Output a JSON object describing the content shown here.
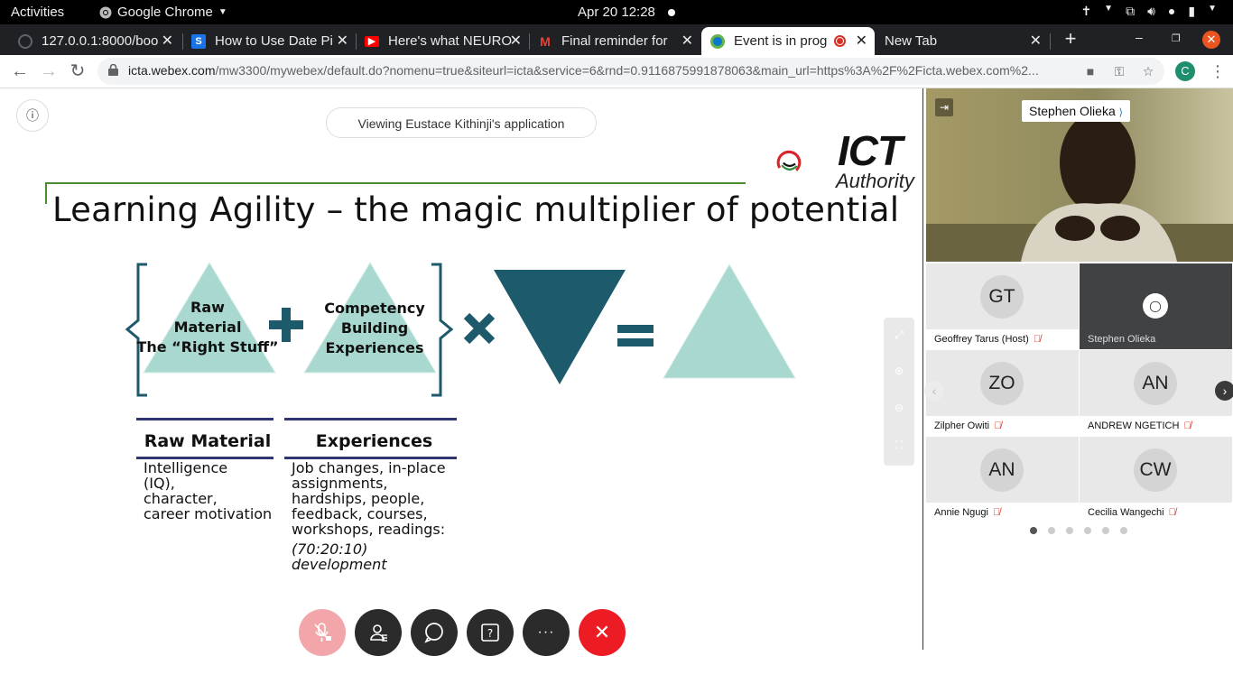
{
  "system": {
    "activities": "Activities",
    "app_name": "Google Chrome",
    "clock": "Apr 20  12:28"
  },
  "tabs": [
    {
      "title": "127.0.0.1:8000/boo",
      "favicon": "globe-icon"
    },
    {
      "title": "How to Use Date Pi",
      "favicon": "s-icon",
      "color": "#1a73e8"
    },
    {
      "title": "Here's what NEURO",
      "favicon": "youtube-icon",
      "color": "#ff0000"
    },
    {
      "title": "Final reminder for",
      "favicon": "gmail-icon",
      "color": "#ea4335"
    },
    {
      "title": "Event is in prog",
      "favicon": "webex-icon",
      "active": true
    },
    {
      "title": "New Tab",
      "favicon": "none"
    }
  ],
  "omnibox": {
    "host": "icta.webex.com",
    "path": "/mw3300/mywebex/default.do?nomenu=true&siteurl=icta&service=6&rnd=0.9116875991878063&main_url=https%3A%2F%2Ficta.webex.com%2...",
    "profile_initial": "C"
  },
  "meeting": {
    "viewing_label": "Viewing Eustace Kithinji's application",
    "speaker_name": "Stephen Olieka"
  },
  "slide": {
    "title": "Learning Agility – the magic multiplier of potential",
    "logo_text": "ICT",
    "logo_subtext": "Authority",
    "triangle1_label": "Raw\nMaterial\nThe “Right Stuff”",
    "triangle2_label": "Competency\nBuilding\nExperiences",
    "plus_symbol": "+",
    "times_symbol": "×",
    "equals_symbol": "=",
    "col1_head": "Raw Material",
    "col1_text": "Intelligence\n(IQ),\ncharacter,\ncareer motivation",
    "col2_head": "Experiences",
    "col2_text": "Job changes, in-place\nassignments,\nhardships, people,\nfeedback, courses,\nworkshops, readings:",
    "col2_italic": "(70:20:10)\ndevelopment"
  },
  "participants": [
    {
      "initials": "GT",
      "name": "Geoffrey Tarus (Host)",
      "muted": true
    },
    {
      "initials": "",
      "name": "Stephen Olieka",
      "muted": false,
      "speaking": true
    },
    {
      "initials": "ZO",
      "name": "Zilpher Owiti",
      "muted": true
    },
    {
      "initials": "AN",
      "name": "ANDREW NGETICH",
      "muted": true
    },
    {
      "initials": "AN",
      "name": "Annie Ngugi",
      "muted": true
    },
    {
      "initials": "CW",
      "name": "Cecilia Wangechi",
      "muted": true
    }
  ],
  "pager": {
    "pages": 6,
    "current": 1
  },
  "colors": {
    "teal_light": "#a8d8cf",
    "teal_dark": "#1d5a6b",
    "end_red": "#ed1c24",
    "mute_pink": "#f2a6aa",
    "slide_green": "#4b8c33",
    "navy_line": "#2f3570"
  }
}
